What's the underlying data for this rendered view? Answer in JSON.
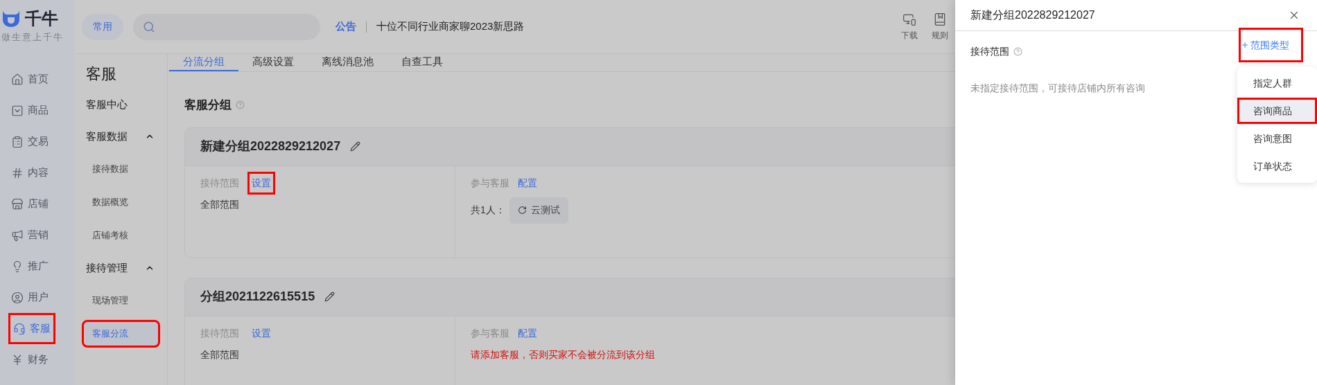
{
  "app": {
    "logo_text": "千牛",
    "slogan": "做生意上千牛"
  },
  "nav": [
    {
      "label": "首页",
      "selected": false,
      "highlighted": false
    },
    {
      "label": "商品",
      "selected": false,
      "highlighted": false
    },
    {
      "label": "交易",
      "selected": false,
      "highlighted": false
    },
    {
      "label": "内容",
      "selected": false,
      "highlighted": false
    },
    {
      "label": "店铺",
      "selected": false,
      "highlighted": false
    },
    {
      "label": "营销",
      "selected": false,
      "highlighted": false
    },
    {
      "label": "推广",
      "selected": false,
      "highlighted": false
    },
    {
      "label": "用户",
      "selected": false,
      "highlighted": false
    },
    {
      "label": "客服",
      "selected": true,
      "highlighted": true
    },
    {
      "label": "财务",
      "selected": false,
      "highlighted": false
    }
  ],
  "top_bar": {
    "pill": "常用",
    "notice_label": "公告",
    "notice": "十位不同行业商家聊2023新思路",
    "tools": [
      {
        "label": "下载"
      },
      {
        "label": "规则"
      }
    ]
  },
  "sub_nav": {
    "title": "客服",
    "items": [
      {
        "label": "客服中心",
        "kind": "link"
      },
      {
        "label": "客服数据",
        "kind": "group",
        "expanded": true,
        "children": [
          {
            "label": "接待数据",
            "selected": false,
            "highlighted": false
          },
          {
            "label": "数据概览",
            "selected": false,
            "highlighted": false
          },
          {
            "label": "店铺考核",
            "selected": false,
            "highlighted": false
          }
        ]
      },
      {
        "label": "接待管理",
        "kind": "group",
        "expanded": true,
        "children": [
          {
            "label": "现场管理",
            "selected": false,
            "highlighted": false
          },
          {
            "label": "客服分流",
            "selected": true,
            "highlighted": true
          }
        ]
      }
    ]
  },
  "tabs": [
    {
      "label": "分流分组",
      "selected": true
    },
    {
      "label": "高级设置",
      "selected": false
    },
    {
      "label": "离线消息池",
      "selected": false
    },
    {
      "label": "自查工具",
      "selected": false
    }
  ],
  "section_title": "客服分组",
  "groups": [
    {
      "name": "新建分组2022829212027",
      "scope_label": "接待范围",
      "scope_action": "设置",
      "scope_action_highlighted": true,
      "scope_value": "全部范围",
      "staff_label": "参与客服",
      "staff_action": "配置",
      "staff_count": "共1人：",
      "staff": [
        "云测试"
      ]
    },
    {
      "name": "分组2021122615515",
      "scope_label": "接待范围",
      "scope_action": "设置",
      "scope_action_highlighted": false,
      "scope_value": "全部范围",
      "staff_label": "参与客服",
      "staff_action": "配置",
      "warning": "请添加客服，否则买家不会被分流到该分组"
    }
  ],
  "drawer": {
    "title": "新建分组2022829212027",
    "field_label": "接待范围",
    "add_button": {
      "label": "范围类型",
      "highlighted": true
    },
    "empty_text": "未指定接待范围，可接待店铺内所有咨询",
    "menu": [
      {
        "label": "指定人群",
        "hovered": false,
        "highlighted": false
      },
      {
        "label": "咨询商品",
        "hovered": true,
        "highlighted": true
      },
      {
        "label": "咨询意图",
        "hovered": false,
        "highlighted": false
      },
      {
        "label": "订单状态",
        "hovered": false,
        "highlighted": false
      }
    ]
  }
}
